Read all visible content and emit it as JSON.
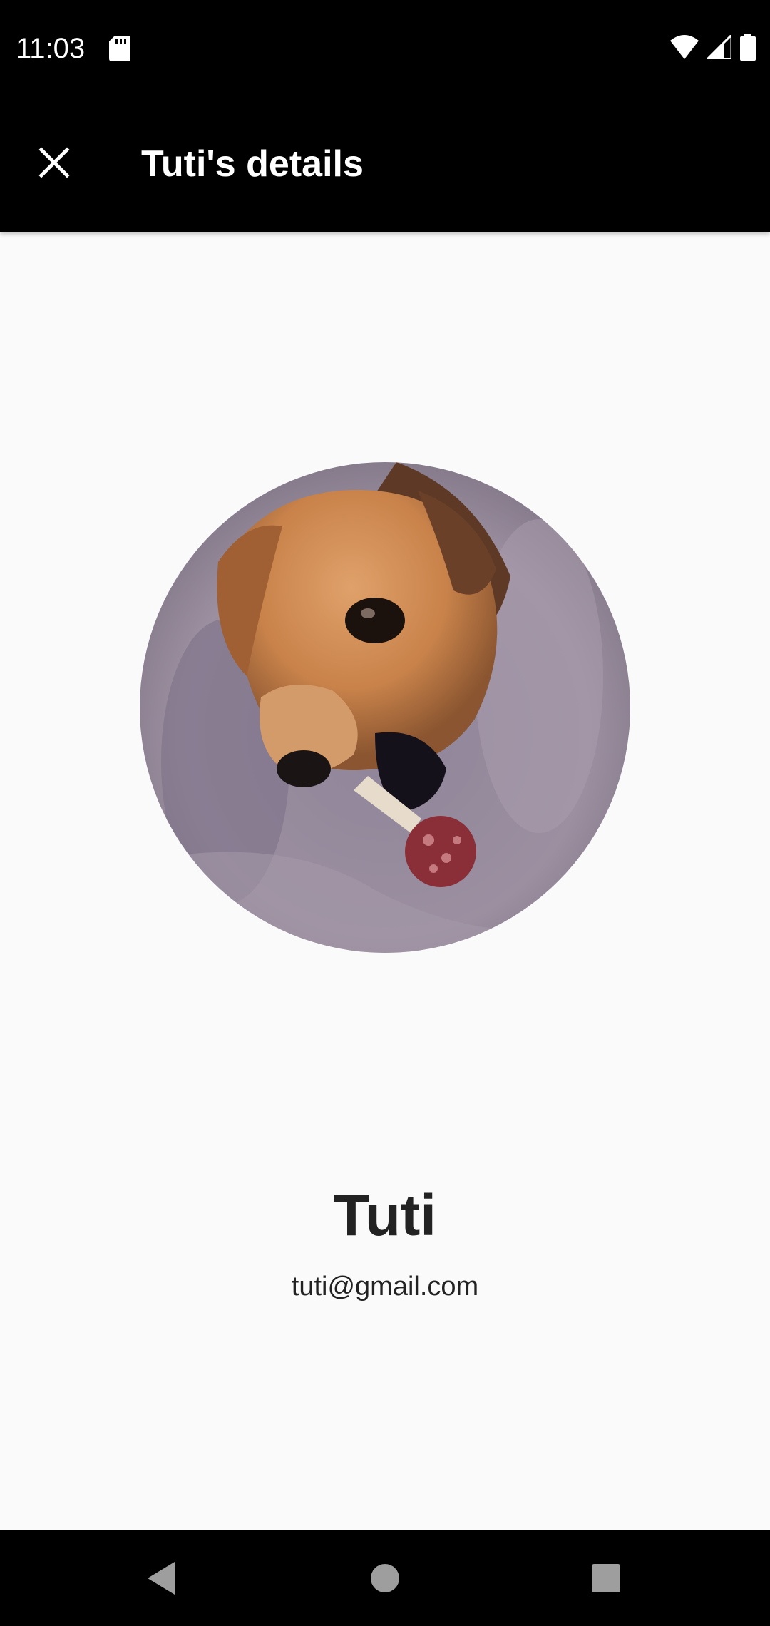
{
  "status_bar": {
    "time": "11:03",
    "icons": [
      "sd-card-icon",
      "wifi-icon",
      "cell-signal-icon",
      "battery-icon"
    ]
  },
  "app_bar": {
    "title": "Tuti's details",
    "close_icon": "close-icon"
  },
  "profile": {
    "name": "Tuti",
    "email": "tuti@gmail.com"
  },
  "nav_bar": {
    "icons": [
      "back-icon",
      "home-icon",
      "recents-icon"
    ]
  },
  "colors": {
    "bars": "#000000",
    "background": "#fafafa",
    "text": "#222222"
  }
}
